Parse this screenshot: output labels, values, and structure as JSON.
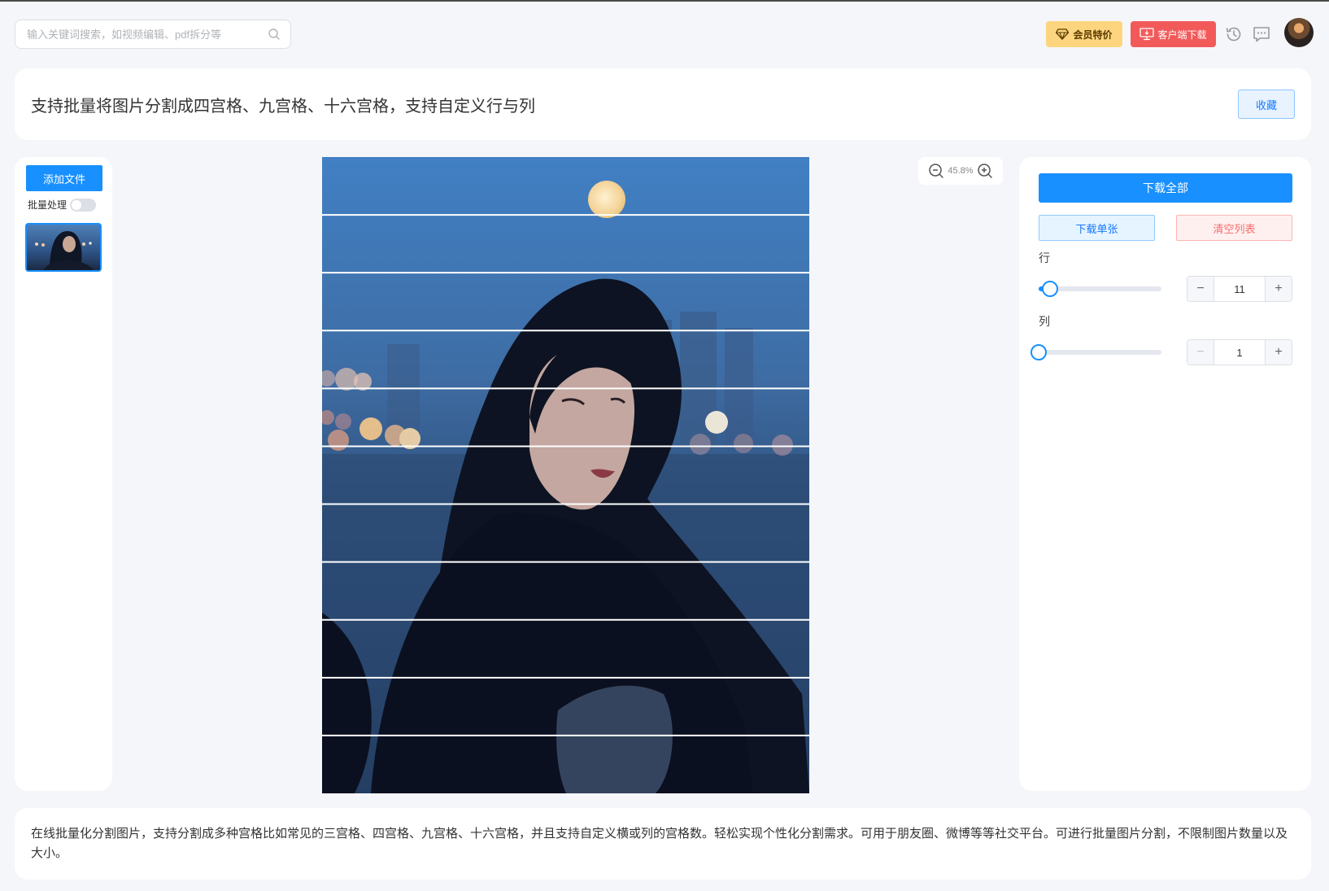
{
  "header": {
    "search_placeholder": "输入关键词搜索，如视频编辑、pdf拆分等",
    "vip_label": "会员特价",
    "client_download_label": "客户端下载"
  },
  "title_card": {
    "title": "支持批量将图片分割成四宫格、九宫格、十六宫格，支持自定义行与列",
    "favorite_label": "收藏"
  },
  "left_panel": {
    "add_file_label": "添加文件",
    "batch_label": "批量处理",
    "batch_enabled": false
  },
  "preview": {
    "zoom_level": "45.8%",
    "rows": 11,
    "cols": 1
  },
  "right_panel": {
    "download_all_label": "下载全部",
    "download_single_label": "下载单张",
    "clear_list_label": "清空列表",
    "rows_label": "行",
    "cols_label": "列",
    "rows_value": "11",
    "cols_value": "1",
    "rows_slider_fraction": 0.09,
    "cols_slider_fraction": 0.0
  },
  "description": {
    "text": "在线批量化分割图片，支持分割成多种宫格比如常见的三宫格、四宫格、九宫格、十六宫格，并且支持自定义横或列的宫格数。轻松实现个性化分割需求。可用于朋友圈、微博等等社交平台。可进行批量图片分割，不限制图片数量以及大小。"
  },
  "colors": {
    "primary": "#1890ff",
    "vip": "#fcd57e",
    "client": "#f25a5a",
    "danger_text": "#f56c6c"
  },
  "icons": [
    "search-icon",
    "diamond-icon",
    "monitor-icon",
    "history-icon",
    "message-icon",
    "zoom-out-icon",
    "zoom-in-icon"
  ]
}
